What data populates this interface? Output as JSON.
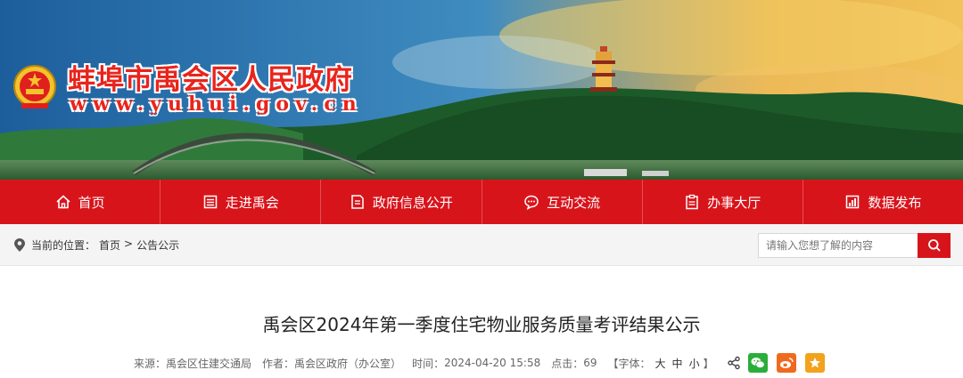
{
  "site": {
    "title": "蚌埠市禹会区人民政府",
    "url": "www.yuhui.gov.cn"
  },
  "nav": {
    "items": [
      {
        "label": "首页",
        "icon": "home-icon"
      },
      {
        "label": "走进禹会",
        "icon": "list-icon"
      },
      {
        "label": "政府信息公开",
        "icon": "document-icon"
      },
      {
        "label": "互动交流",
        "icon": "chat-icon"
      },
      {
        "label": "办事大厅",
        "icon": "clipboard-icon"
      },
      {
        "label": "数据发布",
        "icon": "bar-chart-icon"
      }
    ]
  },
  "breadcrumb": {
    "prefix": "当前的位置：",
    "home": "首页",
    "separator": ">",
    "current": "公告公示"
  },
  "search": {
    "placeholder": "请输入您想了解的内容"
  },
  "article": {
    "title": "禹会区2024年第一季度住宅物业服务质量考评结果公示",
    "source_label": "来源：",
    "source": "禹会区住建交通局",
    "author_label": "作者：",
    "author": "禹会区政府（办公室）",
    "time_label": "时间：",
    "time": "2024-04-20 15:58",
    "clicks_label": "点击：",
    "clicks": "69",
    "font_label": "【字体：",
    "font_large": "大",
    "font_medium": "中",
    "font_small": "小",
    "font_close": "】"
  },
  "share": [
    "wechat-icon",
    "weibo-icon",
    "favorite-star-icon"
  ],
  "colors": {
    "brand_red": "#d8141b",
    "wechat": "#2aae3a",
    "weibo": "#f06a1e",
    "favorite": "#f3a21c"
  }
}
